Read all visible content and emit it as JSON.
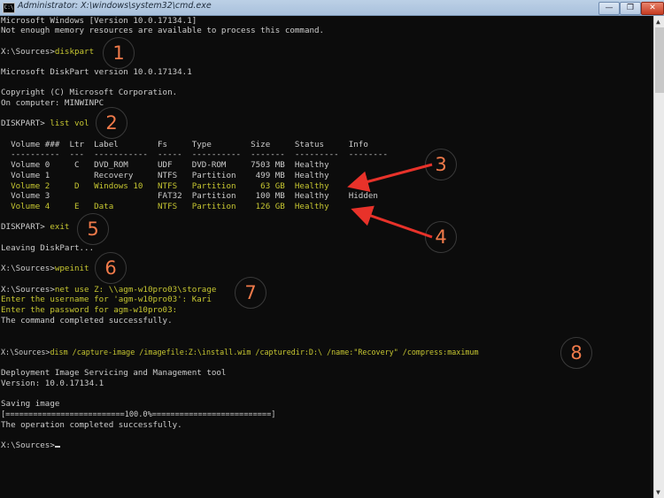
{
  "window": {
    "title": "Administrator: X:\\windows\\system32\\cmd.exe",
    "minimize_glyph": "—",
    "restore_glyph": "❐",
    "close_glyph": "✕"
  },
  "console": {
    "lines": [
      {
        "t": "Microsoft Windows [Version 10.0.17134.1]"
      },
      {
        "t": "Not enough memory resources are available to process this command."
      },
      {
        "prompt": "X:\\Sources>",
        "cmd": "diskpart"
      },
      {
        "t": "Microsoft DiskPart version 10.0.17134.1"
      },
      {
        "t": "Copyright (C) Microsoft Corporation."
      },
      {
        "t": "On computer: MINWINPC"
      },
      {
        "prompt": "DISKPART> ",
        "cmd": "list vol"
      },
      {
        "t": "  Volume ###  Ltr  Label        Fs     Type        Size     Status     Info"
      },
      {
        "t": "  ----------  ---  -----------  -----  ----------  -------  ---------  --------"
      },
      {
        "t": "  Volume 0     C   DVD_ROM      UDF    DVD-ROM     7503 MB  Healthy"
      },
      {
        "t": "  Volume 1         Recovery     NTFS   Partition    499 MB  Healthy"
      },
      {
        "t": "  Volume 2     D   Windows 10   NTFS   Partition     63 GB  Healthy",
        "hl": true
      },
      {
        "t": "  Volume 3                      FAT32  Partition    100 MB  Healthy    Hidden"
      },
      {
        "t": "  Volume 4     E   Data         NTFS   Partition    126 GB  Healthy",
        "hl": true
      },
      {
        "prompt": "DISKPART> ",
        "cmd": "exit"
      },
      {
        "t": "Leaving DiskPart..."
      },
      {
        "prompt": "X:\\Sources>",
        "cmd": "wpeinit"
      },
      {
        "prompt": "X:\\Sources>",
        "cmd": "net use Z: \\\\agm-w10pro03\\storage"
      },
      {
        "t": "Enter the username for 'agm-w10pro03': Kari",
        "hl": true
      },
      {
        "t": "Enter the password for agm-w10pro03:",
        "hl": true
      },
      {
        "t": "The command completed successfully."
      },
      {
        "prompt": "X:\\Sources>",
        "cmd": "dism /capture-image /imagefile:Z:\\install.wim /capturedir:D:\\ /name:\"Recovery\" /compress:maximum"
      },
      {
        "t": "Deployment Image Servicing and Management tool"
      },
      {
        "t": "Version: 10.0.17134.1"
      },
      {
        "t": "Saving image"
      },
      {
        "t": "[==========================100.0%==========================]"
      },
      {
        "t": "The operation completed successfully."
      },
      {
        "prompt": "X:\\Sources>",
        "cmd": ""
      }
    ]
  },
  "progress": {
    "percent": 100.0
  },
  "volumes": {
    "columns": [
      "Volume ###",
      "Ltr",
      "Label",
      "Fs",
      "Type",
      "Size",
      "Status",
      "Info"
    ],
    "rows": [
      [
        "Volume 0",
        "C",
        "DVD_ROM",
        "UDF",
        "DVD-ROM",
        "7503 MB",
        "Healthy",
        ""
      ],
      [
        "Volume 1",
        "",
        "Recovery",
        "NTFS",
        "Partition",
        "499 MB",
        "Healthy",
        ""
      ],
      [
        "Volume 2",
        "D",
        "Windows 10",
        "NTFS",
        "Partition",
        "63 GB",
        "Healthy",
        ""
      ],
      [
        "Volume 3",
        "",
        "",
        "FAT32",
        "Partition",
        "100 MB",
        "Healthy",
        "Hidden"
      ],
      [
        "Volume 4",
        "E",
        "Data",
        "NTFS",
        "Partition",
        "126 GB",
        "Healthy",
        ""
      ]
    ]
  },
  "annotations": [
    "1",
    "2",
    "3",
    "4",
    "5",
    "6",
    "7",
    "8"
  ],
  "colors": {
    "background": "#0c0c0c",
    "text": "#cccccc",
    "highlight": "#c6c631",
    "annotation": "#f07a4a",
    "arrow": "#e8322a"
  }
}
